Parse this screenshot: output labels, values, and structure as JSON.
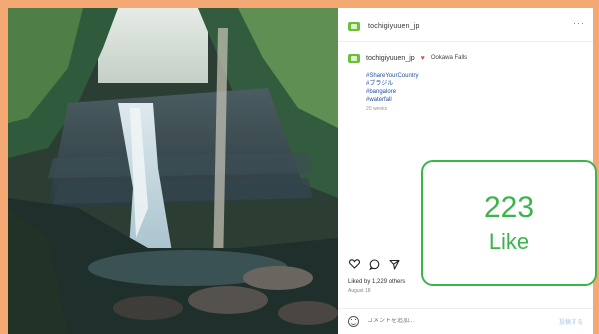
{
  "post": {
    "username": "tochigiyuuen_jp",
    "caption_user": "tochigiyuuen_jp",
    "caption_title": "Ookawa Falls",
    "hashtags": [
      "#ShareYourCountry",
      "#ブラジル",
      "#bangalore",
      "#waterfall"
    ],
    "time_ago": "20 weeks",
    "likes_text": "Liked by 1,229 others",
    "date_text": "August 18"
  },
  "like_overlay": {
    "count": "223",
    "word": "Like"
  },
  "comment": {
    "placeholder": "コメントを追加...",
    "post_label": "投稿する"
  },
  "icons": {
    "more": "more-dots-icon",
    "heart": "heart-icon",
    "comment": "comment-icon",
    "share": "share-icon",
    "emoji": "smiley-icon"
  },
  "colors": {
    "background": "#f4a873",
    "accent": "#3ab54a",
    "hashtag": "#1f4f9c"
  }
}
